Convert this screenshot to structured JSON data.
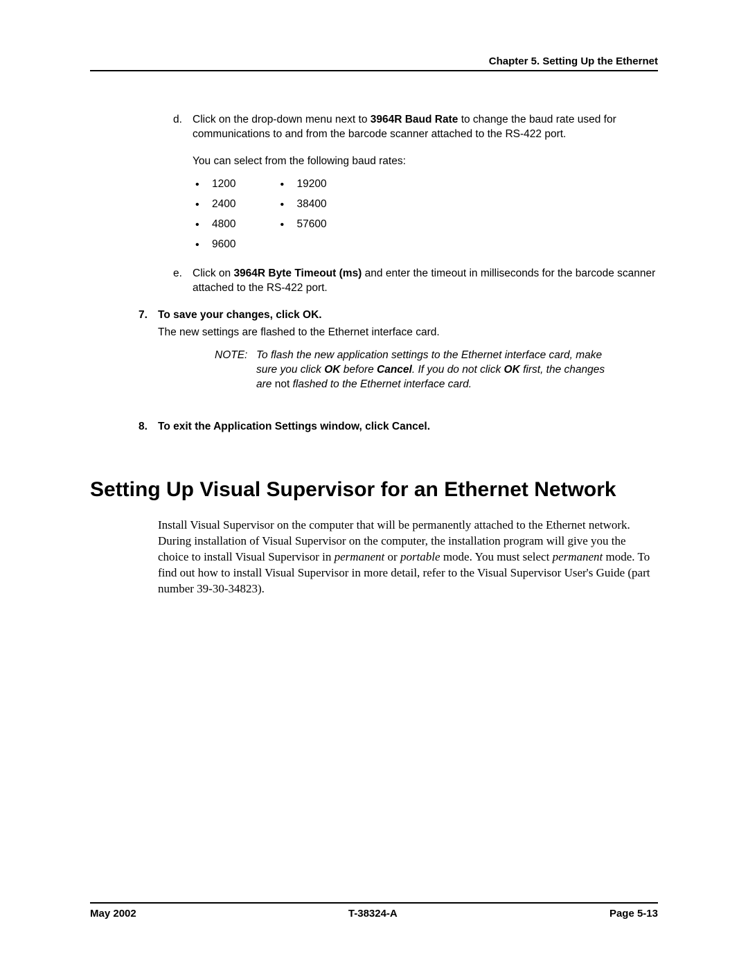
{
  "header": {
    "chapter": "Chapter 5. Setting Up the Ethernet"
  },
  "item_d": {
    "marker": "d.",
    "pre": "Click on the drop-down menu next to ",
    "bold": "3964R Baud Rate",
    "post": " to change the baud rate used for communications to and from the barcode scanner attached to the RS-422 port.",
    "intro": "You can select from the following baud rates:",
    "col1": [
      "1200",
      "2400",
      "4800",
      "9600"
    ],
    "col2": [
      "19200",
      "38400",
      "57600"
    ]
  },
  "item_e": {
    "marker": "e.",
    "pre": "Click on ",
    "bold": "3964R Byte Timeout (ms)",
    "post": " and enter the timeout in milliseconds for the barcode scanner attached to the RS-422 port."
  },
  "item_7": {
    "marker": "7.",
    "lead": "To save your changes, click OK.",
    "after": "The new settings are flashed to the Ethernet interface card.",
    "note_label": "NOTE:",
    "note_1": "To flash the new application settings to the Ethernet interface card, make sure you click ",
    "note_ok": "OK",
    "note_2": " before ",
    "note_cancel": "Cancel",
    "note_3": ". If you do not click ",
    "note_ok2": "OK",
    "note_4": " first, the changes are ",
    "note_not": "not",
    "note_5": " flashed to the Ethernet interface card."
  },
  "item_8": {
    "marker": "8.",
    "lead": "To exit the Application Settings window, click Cancel."
  },
  "section": {
    "title": "Setting Up Visual Supervisor for an Ethernet Network",
    "p1a": "Install Visual Supervisor on the computer that will be permanently attached to the Ethernet network. During installation of Visual Supervisor on the computer, the installation program will give you the choice to install Visual Supervisor in ",
    "p1b": "permanent",
    "p1c": " or ",
    "p1d": "portable",
    "p1e": " mode. You must select ",
    "p1f": "permanent",
    "p1g": " mode. To find out how to install Visual Supervisor in more detail, refer to the Visual Supervisor User's Guide (part number 39-30-34823)."
  },
  "footer": {
    "date": "May 2002",
    "doc": "T-38324-A",
    "page": "Page 5-13"
  }
}
